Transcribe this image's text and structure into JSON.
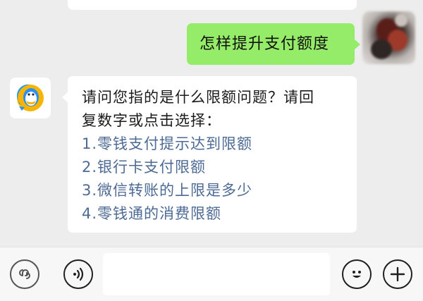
{
  "conversation": {
    "outgoing_message": "怎样提升支付额度",
    "bot_reply": {
      "intro_lines": [
        "请问您指的是什么限额问题？请回",
        "复数字或点击选择："
      ],
      "options": [
        "1.零钱支付提示达到限额",
        "2.银行卡支付限额",
        "3.微信转账的上限是多少",
        "4.零钱通的消费限额"
      ]
    }
  },
  "icons": {
    "bot_avatar": "qq-penguin-logo-icon",
    "mini_program": "mini-program-icon",
    "voice": "voice-icon",
    "emoji": "emoji-icon",
    "more": "plus-icon"
  },
  "colors": {
    "outgoing_bubble": "#95ec69",
    "option_link": "#4d6a94",
    "background": "#ededed"
  },
  "input": {
    "value": "",
    "placeholder": ""
  }
}
